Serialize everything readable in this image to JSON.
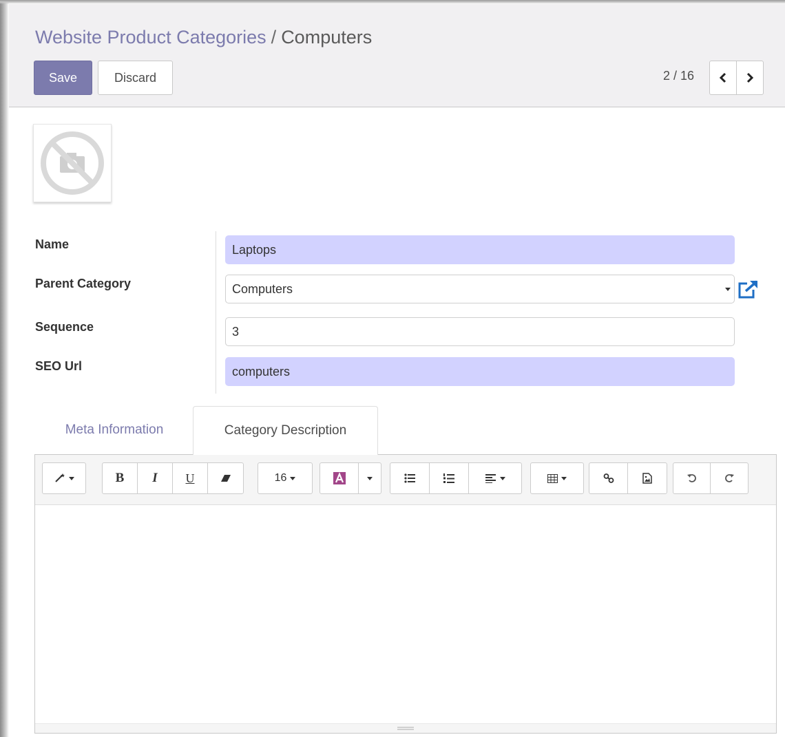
{
  "breadcrumb": {
    "parent": "Website Product Categories",
    "separator": "/",
    "current": "Computers"
  },
  "buttons": {
    "save": "Save",
    "discard": "Discard"
  },
  "pager": {
    "value": "2 / 16"
  },
  "form": {
    "name_label": "Name",
    "name_value": "Laptops",
    "parent_label": "Parent Category",
    "parent_value": "Computers",
    "sequence_label": "Sequence",
    "sequence_value": "3",
    "seo_label": "SEO Url",
    "seo_value": "computers"
  },
  "tabs": {
    "meta": "Meta Information",
    "description": "Category Description"
  },
  "toolbar": {
    "font_size": "16",
    "icons": [
      "magic-wand-icon",
      "bold-icon",
      "italic-icon",
      "underline-icon",
      "eraser-icon",
      "font-color-icon",
      "unordered-list-icon",
      "ordered-list-icon",
      "align-icon",
      "table-icon",
      "link-icon",
      "image-icon",
      "undo-icon",
      "redo-icon"
    ]
  },
  "colors": {
    "accent": "#7c7bad",
    "required_field": "#d2d2ff",
    "panel_bg": "#f1f0f2",
    "link_icon": "#1f6fc5",
    "font_color_swatch": "#a24689"
  }
}
